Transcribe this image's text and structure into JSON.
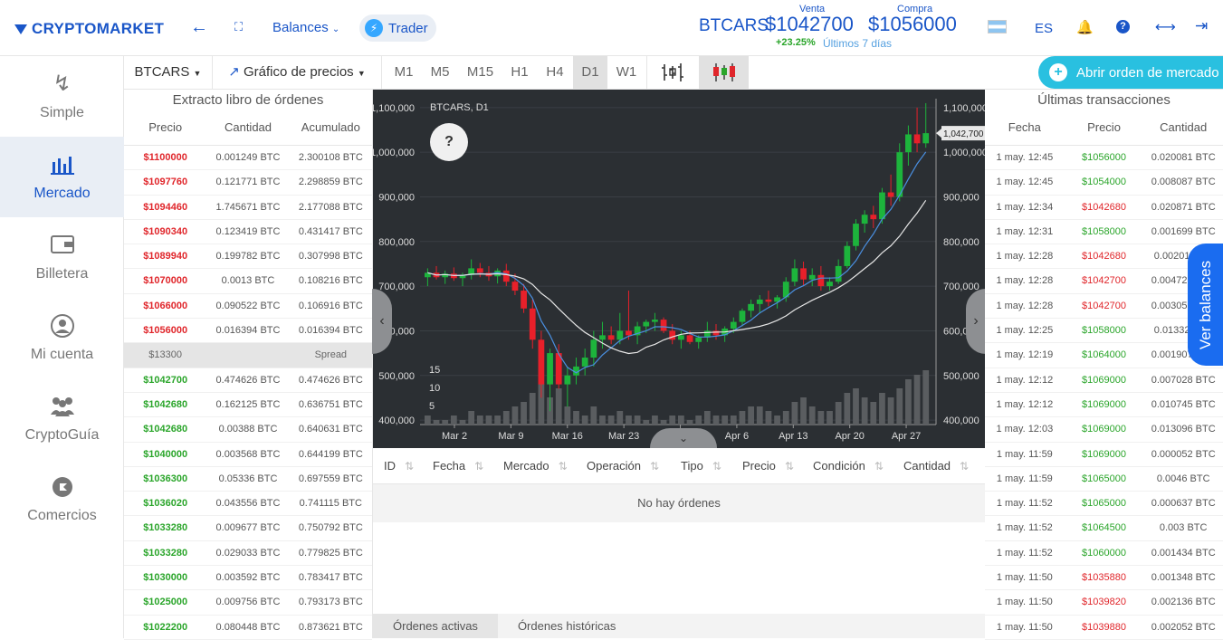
{
  "header": {
    "logo": "CRYPTOMARKET",
    "balances_label": "Balances",
    "trader_label": "Trader",
    "ticker": "BTCARS",
    "sell_label": "Venta",
    "sell_price": "$1042700",
    "buy_label": "Compra",
    "buy_price": "$1056000",
    "change": "+23.25%",
    "change_period": "Últimos 7 días",
    "language": "ES"
  },
  "nav": [
    {
      "label": "Simple",
      "icon": "bolt-icon"
    },
    {
      "label": "Mercado",
      "icon": "bar-chart-icon",
      "active": true
    },
    {
      "label": "Billetera",
      "icon": "wallet-icon"
    },
    {
      "label": "Mi cuenta",
      "icon": "user-icon"
    },
    {
      "label": "CryptoGuía",
      "icon": "people-icon"
    },
    {
      "label": "Comercios",
      "icon": "store-icon"
    }
  ],
  "toolbar": {
    "market": "BTCARS",
    "chart_type": "Gráfico de precios",
    "timeframes": [
      "M1",
      "M5",
      "M15",
      "H1",
      "H4",
      "D1",
      "W1"
    ],
    "active_timeframe": "D1",
    "open_order_label": "Abrir orden de mercado"
  },
  "orderbook": {
    "title": "Extracto libro de órdenes",
    "headers": [
      "Precio",
      "Cantidad",
      "Acumulado"
    ],
    "asks": [
      [
        "$1100000",
        "0.001249 BTC",
        "2.300108 BTC"
      ],
      [
        "$1097760",
        "0.121771 BTC",
        "2.298859 BTC"
      ],
      [
        "$1094460",
        "1.745671 BTC",
        "2.177088 BTC"
      ],
      [
        "$1090340",
        "0.123419 BTC",
        "0.431417 BTC"
      ],
      [
        "$1089940",
        "0.199782 BTC",
        "0.307998 BTC"
      ],
      [
        "$1070000",
        "0.0013 BTC",
        "0.108216 BTC"
      ],
      [
        "$1066000",
        "0.090522 BTC",
        "0.106916 BTC"
      ],
      [
        "$1056000",
        "0.016394 BTC",
        "0.016394 BTC"
      ]
    ],
    "spread_value": "$13300",
    "spread_label": "Spread",
    "bids": [
      [
        "$1042700",
        "0.474626 BTC",
        "0.474626 BTC"
      ],
      [
        "$1042680",
        "0.162125 BTC",
        "0.636751 BTC"
      ],
      [
        "$1042680",
        "0.00388 BTC",
        "0.640631 BTC"
      ],
      [
        "$1040000",
        "0.003568 BTC",
        "0.644199 BTC"
      ],
      [
        "$1036300",
        "0.05336 BTC",
        "0.697559 BTC"
      ],
      [
        "$1036020",
        "0.043556 BTC",
        "0.741115 BTC"
      ],
      [
        "$1033280",
        "0.009677 BTC",
        "0.750792 BTC"
      ],
      [
        "$1033280",
        "0.029033 BTC",
        "0.779825 BTC"
      ],
      [
        "$1030000",
        "0.003592 BTC",
        "0.783417 BTC"
      ],
      [
        "$1025000",
        "0.009756 BTC",
        "0.793173 BTC"
      ],
      [
        "$1022200",
        "0.080448 BTC",
        "0.873621 BTC"
      ]
    ]
  },
  "transactions": {
    "title": "Últimas transacciones",
    "headers": [
      "Fecha",
      "Precio",
      "Cantidad"
    ],
    "rows": [
      [
        "1 may. 12:45",
        "$1056000",
        "0.020081 BTC",
        "buy"
      ],
      [
        "1 may. 12:45",
        "$1054000",
        "0.008087 BTC",
        "buy"
      ],
      [
        "1 may. 12:34",
        "$1042680",
        "0.020871 BTC",
        "sell"
      ],
      [
        "1 may. 12:31",
        "$1058000",
        "0.001699 BTC",
        "buy"
      ],
      [
        "1 may. 12:28",
        "$1042680",
        "0.00201 BTC",
        "sell"
      ],
      [
        "1 may. 12:28",
        "$1042700",
        "0.004725 BTC",
        "sell"
      ],
      [
        "1 may. 12:28",
        "$1042700",
        "0.003052 BTC",
        "sell"
      ],
      [
        "1 may. 12:25",
        "$1058000",
        "0.01332 BTC",
        "buy"
      ],
      [
        "1 may. 12:19",
        "$1064000",
        "0.001907 BTC",
        "buy"
      ],
      [
        "1 may. 12:12",
        "$1069000",
        "0.007028 BTC",
        "buy"
      ],
      [
        "1 may. 12:12",
        "$1069000",
        "0.010745 BTC",
        "buy"
      ],
      [
        "1 may. 12:03",
        "$1069000",
        "0.013096 BTC",
        "buy"
      ],
      [
        "1 may. 11:59",
        "$1069000",
        "0.000052 BTC",
        "buy"
      ],
      [
        "1 may. 11:59",
        "$1065000",
        "0.0046 BTC",
        "buy"
      ],
      [
        "1 may. 11:52",
        "$1065000",
        "0.000637 BTC",
        "buy"
      ],
      [
        "1 may. 11:52",
        "$1064500",
        "0.003 BTC",
        "buy"
      ],
      [
        "1 may. 11:52",
        "$1060000",
        "0.001434 BTC",
        "buy"
      ],
      [
        "1 may. 11:50",
        "$1035880",
        "0.001348 BTC",
        "sell"
      ],
      [
        "1 may. 11:50",
        "$1039820",
        "0.002136 BTC",
        "sell"
      ],
      [
        "1 may. 11:50",
        "$1039880",
        "0.002052 BTC",
        "sell"
      ]
    ]
  },
  "ver_balances": "Ver balances",
  "orders": {
    "headers": [
      "ID",
      "Fecha",
      "Mercado",
      "Operación",
      "Tipo",
      "Precio",
      "Condición",
      "Cantidad"
    ],
    "empty_text": "No hay órdenes",
    "tabs": [
      "Órdenes activas",
      "Órdenes históricas"
    ]
  },
  "colors": {
    "brand": "#1a56c8",
    "buy": "#2aa52a",
    "sell": "#e0262b",
    "chart_bg": "#2b2f33",
    "candle_up": "#1db43c",
    "candle_down": "#e8202a",
    "accent": "#29c0e0"
  },
  "chart_data": {
    "type": "candlestick",
    "title": "BTCARS, D1",
    "help_label": "?",
    "current_price_label": "1,042,700",
    "ylim": [
      390000,
      1120000
    ],
    "yticks": [
      "400,000",
      "500,000",
      "600,000",
      "700,000",
      "800,000",
      "900,000",
      "1,000,000",
      "1,100,000"
    ],
    "ytick_values": [
      400000,
      500000,
      600000,
      700000,
      800000,
      900000,
      1000000,
      1100000
    ],
    "xticks": [
      "Mar 2",
      "Mar 9",
      "Mar 16",
      "Mar 23",
      "Mar 30",
      "Apr 6",
      "Apr 13",
      "Apr 20",
      "Apr 27"
    ],
    "volume_ticks": [
      "15",
      "10",
      "5"
    ],
    "candles": [
      [
        720000,
        740000,
        700000,
        730000
      ],
      [
        730000,
        745000,
        715000,
        720000
      ],
      [
        720000,
        735000,
        705000,
        728000
      ],
      [
        728000,
        742000,
        712000,
        718000
      ],
      [
        718000,
        730000,
        700000,
        725000
      ],
      [
        725000,
        760000,
        715000,
        740000
      ],
      [
        740000,
        752000,
        720000,
        730000
      ],
      [
        730000,
        745000,
        712000,
        722000
      ],
      [
        722000,
        740000,
        706000,
        735000
      ],
      [
        735000,
        750000,
        700000,
        710000
      ],
      [
        710000,
        728000,
        680000,
        690000
      ],
      [
        690000,
        705000,
        640000,
        650000
      ],
      [
        650000,
        670000,
        560000,
        580000
      ],
      [
        580000,
        600000,
        450000,
        480000
      ],
      [
        480000,
        560000,
        420000,
        550000
      ],
      [
        550000,
        570000,
        470000,
        480000
      ],
      [
        480000,
        520000,
        430000,
        500000
      ],
      [
        500000,
        540000,
        480000,
        520000
      ],
      [
        520000,
        560000,
        500000,
        540000
      ],
      [
        540000,
        600000,
        520000,
        580000
      ],
      [
        580000,
        620000,
        560000,
        590000
      ],
      [
        590000,
        610000,
        570000,
        580000
      ],
      [
        580000,
        640000,
        570000,
        600000
      ],
      [
        600000,
        690000,
        580000,
        590000
      ],
      [
        590000,
        620000,
        570000,
        610000
      ],
      [
        610000,
        625000,
        595000,
        620000
      ],
      [
        620000,
        640000,
        600000,
        625000
      ],
      [
        625000,
        630000,
        595000,
        600000
      ],
      [
        600000,
        615000,
        570000,
        580000
      ],
      [
        580000,
        600000,
        560000,
        590000
      ],
      [
        590000,
        600000,
        570000,
        575000
      ],
      [
        575000,
        590000,
        560000,
        585000
      ],
      [
        585000,
        620000,
        575000,
        600000
      ],
      [
        600000,
        615000,
        580000,
        590000
      ],
      [
        590000,
        610000,
        575000,
        605000
      ],
      [
        605000,
        630000,
        595000,
        620000
      ],
      [
        620000,
        650000,
        610000,
        645000
      ],
      [
        645000,
        670000,
        630000,
        660000
      ],
      [
        660000,
        680000,
        640000,
        670000
      ],
      [
        670000,
        690000,
        655000,
        665000
      ],
      [
        665000,
        680000,
        650000,
        675000
      ],
      [
        675000,
        720000,
        665000,
        710000
      ],
      [
        710000,
        760000,
        700000,
        740000
      ],
      [
        740000,
        755000,
        700000,
        715000
      ],
      [
        715000,
        740000,
        700000,
        725000
      ],
      [
        725000,
        745000,
        690000,
        700000
      ],
      [
        700000,
        720000,
        690000,
        710000
      ],
      [
        710000,
        760000,
        705000,
        745000
      ],
      [
        745000,
        800000,
        740000,
        790000
      ],
      [
        790000,
        850000,
        780000,
        840000
      ],
      [
        840000,
        870000,
        820000,
        860000
      ],
      [
        860000,
        880000,
        830000,
        850000
      ],
      [
        850000,
        920000,
        840000,
        910000
      ],
      [
        910000,
        950000,
        880000,
        900000
      ],
      [
        900000,
        1020000,
        890000,
        1000000
      ],
      [
        1000000,
        1060000,
        970000,
        1040000
      ],
      [
        1040000,
        1100000,
        1000000,
        1020000
      ],
      [
        1020000,
        1110000,
        1010000,
        1042700
      ]
    ],
    "volumes": [
      2,
      1,
      1,
      2,
      1,
      3,
      2,
      2,
      2,
      3,
      4,
      5,
      7,
      9,
      6,
      8,
      4,
      3,
      2,
      4,
      2,
      2,
      3,
      2,
      2,
      1,
      2,
      1,
      2,
      2,
      1,
      2,
      3,
      2,
      2,
      2,
      3,
      4,
      4,
      3,
      2,
      3,
      5,
      6,
      4,
      3,
      3,
      5,
      7,
      8,
      6,
      5,
      7,
      6,
      8,
      10,
      11,
      12
    ]
  }
}
